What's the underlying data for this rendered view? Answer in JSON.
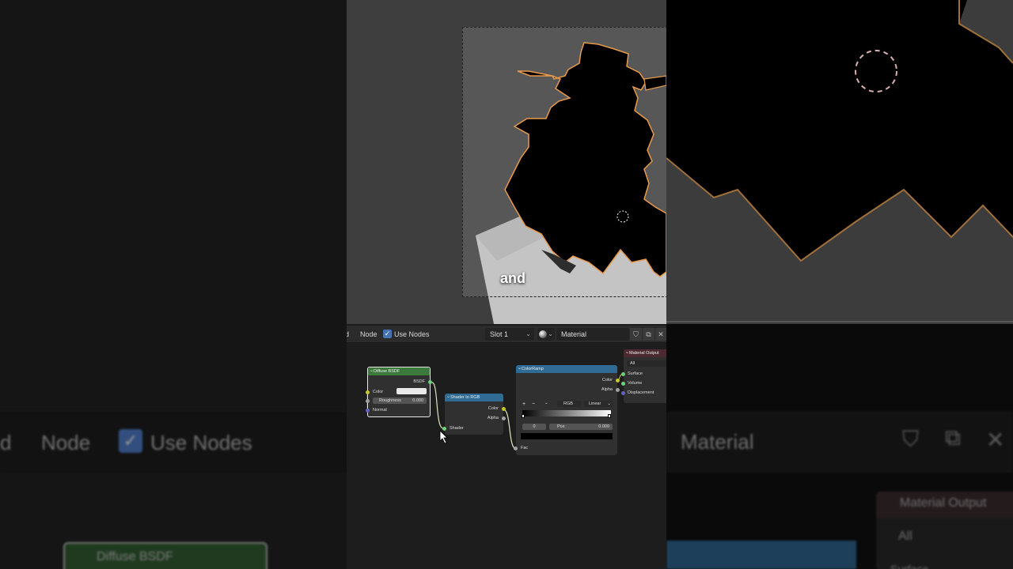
{
  "subtitle": "and",
  "header": {
    "partial_menu": "d",
    "node_menu": "Node",
    "use_nodes_label": "Use Nodes",
    "slot": "Slot 1",
    "material_name": "Material"
  },
  "nodes": {
    "diffuse": {
      "title": "Diffuse BSDF",
      "output": "BSDF",
      "color_label": "Color",
      "roughness_label": "Roughness",
      "roughness_value": "0.000",
      "normal_label": "Normal"
    },
    "shader_to_rgb": {
      "title": "Shader to RGB",
      "color_out": "Color",
      "alpha_out": "Alpha",
      "shader_in": "Shader"
    },
    "color_ramp": {
      "title": "ColorRamp",
      "color_out": "Color",
      "alpha_out": "Alpha",
      "add": "+",
      "remove": "−",
      "menu": "⌄",
      "color_mode": "RGB",
      "interpolation": "Linear",
      "stop_index": "0",
      "pos_label": "Pos",
      "pos_value": "0.000",
      "fac_in": "Fac"
    },
    "material_output": {
      "title": "Material Output",
      "target": "All",
      "surface": "Surface",
      "volume": "Volume",
      "displacement": "Displacement"
    }
  },
  "background_left": {
    "partial": "d",
    "node_menu": "Node",
    "use_nodes_label": "Use Nodes",
    "node_title": "Diffuse BSDF"
  },
  "background_right": {
    "material_name": "Material",
    "node_title": "Material Output",
    "target": "All",
    "surface": "Surface"
  },
  "colors": {
    "diffuse_header": "#3c7a3c",
    "shader_header": "#2f6b94",
    "ramp_header": "#2f6b94",
    "output_header": "#4a2a30",
    "selection_outline": "#e89a4a",
    "socket_shader": "#6ad27a",
    "socket_color": "#c7c729",
    "socket_gray": "#a1a1a1",
    "socket_vector": "#6363c7",
    "link": "#d9e6b8"
  }
}
